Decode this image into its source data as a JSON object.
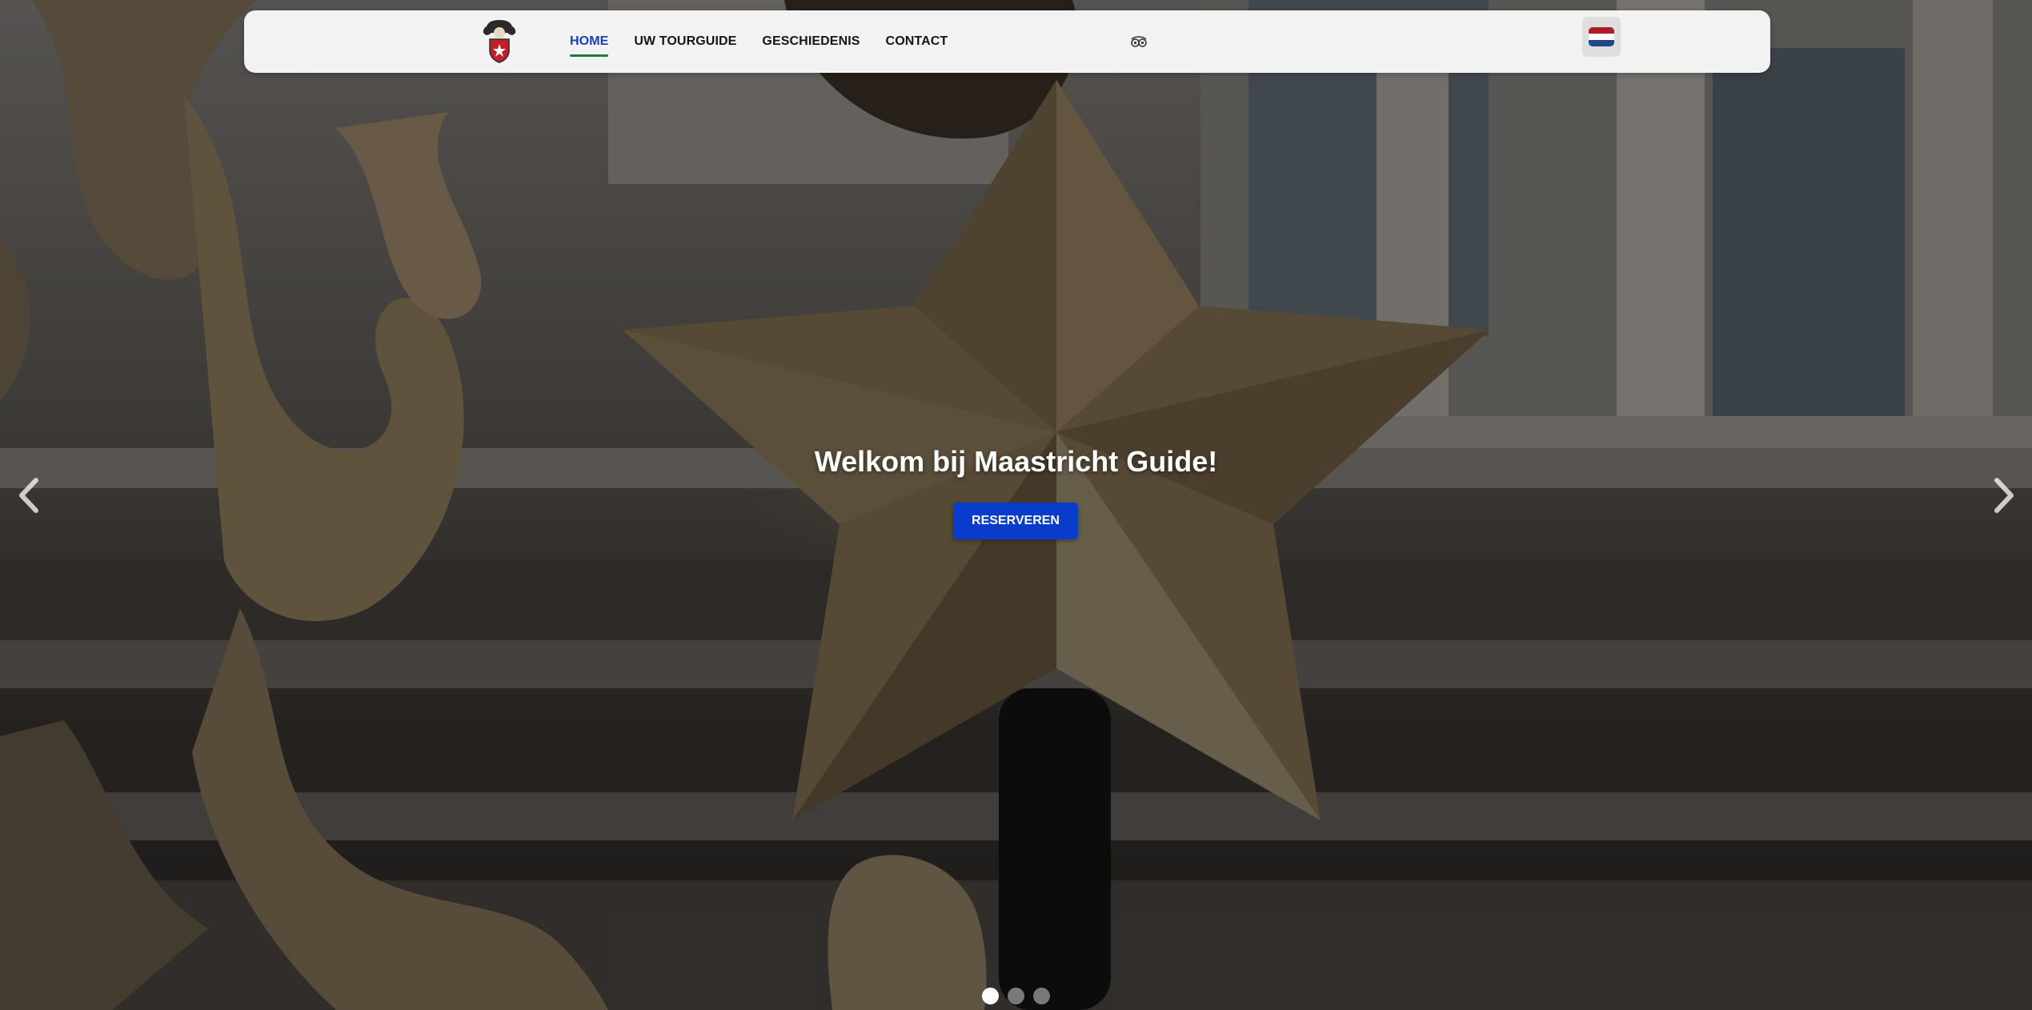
{
  "navbar": {
    "logo_icon": "maastricht-guide-logo",
    "items": [
      {
        "label": "HOME",
        "active": true
      },
      {
        "label": "UW TOURGUIDE",
        "active": false
      },
      {
        "label": "GESCHIEDENIS",
        "active": false
      },
      {
        "label": "CONTACT",
        "active": false
      }
    ],
    "tripadvisor_icon": "tripadvisor-icon",
    "language": {
      "icon": "netherlands-flag-icon",
      "flag_colors": [
        "#ae1c28",
        "#ffffff",
        "#21468b"
      ]
    }
  },
  "hero": {
    "title": "Welkom bij Maastricht Guide!",
    "cta_label": "RESERVEREN",
    "prev_icon": "chevron-left-icon",
    "next_icon": "chevron-right-icon",
    "slides_total": 3,
    "active_slide": 1
  },
  "colors": {
    "accent": "#0a3ccc",
    "active_nav": "#1a3fb8",
    "active_underline": "#1f7a3c",
    "navbar_bg": "#f2f2f2"
  }
}
